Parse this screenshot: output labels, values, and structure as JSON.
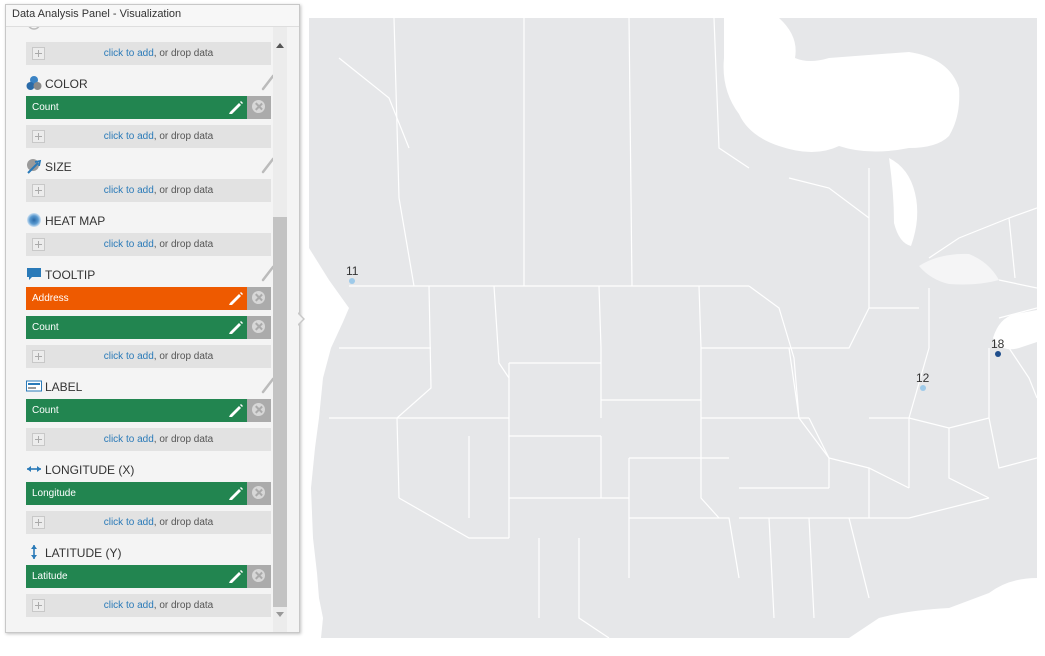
{
  "panel": {
    "title": "Data Analysis Panel - Visualization",
    "drop_text_link": "click to add",
    "drop_text_rest": ", or drop data",
    "sections": {
      "color": {
        "label": "COLOR",
        "fields": [
          "Count"
        ]
      },
      "size": {
        "label": "SIZE"
      },
      "heatmap": {
        "label": "HEAT MAP"
      },
      "tooltip": {
        "label": "TOOLTIP",
        "fields": [
          "Address",
          "Count"
        ]
      },
      "label": {
        "label": "LABEL",
        "fields": [
          "Count"
        ]
      },
      "longitude": {
        "label": "LONGITUDE (X)",
        "fields": [
          "Longitude"
        ]
      },
      "latitude": {
        "label": "LATITUDE (Y)",
        "fields": [
          "Latitude"
        ]
      }
    },
    "colors": {
      "green": "#228550",
      "orange": "#ee5a00",
      "link": "#2a7ab8"
    }
  },
  "map": {
    "points": [
      {
        "label": "11",
        "color": "#9ecae9"
      },
      {
        "label": "12",
        "color": "#9ecae9"
      },
      {
        "label": "18",
        "color": "#1f4e8c"
      }
    ]
  }
}
